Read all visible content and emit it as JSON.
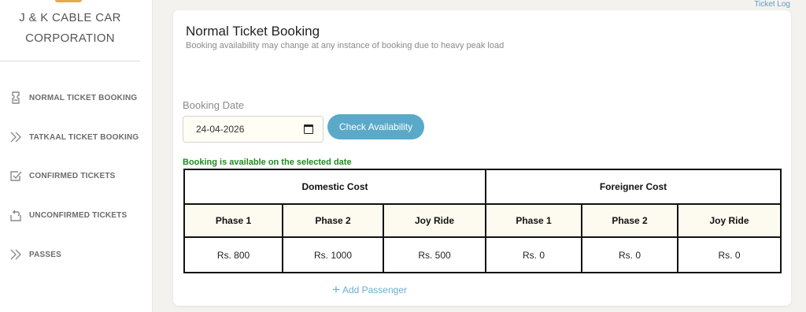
{
  "brand": {
    "line1": "J & K CABLE CAR",
    "line2": "CORPORATION"
  },
  "sidebar": {
    "items": [
      {
        "label": "NORMAL TICKET BOOKING",
        "icon": "ticket-icon"
      },
      {
        "label": "TATKAAL TICKET BOOKING",
        "icon": "double-chevron-icon"
      },
      {
        "label": "CONFIRMED TICKETS",
        "icon": "checkbox-icon"
      },
      {
        "label": "UNCONFIRMED TICKETS",
        "icon": "return-arrow-icon"
      },
      {
        "label": "PASSES",
        "icon": "double-chevron-icon"
      }
    ]
  },
  "header": {
    "ticket_log": "Ticket Log"
  },
  "main": {
    "title": "Normal Ticket Booking",
    "subtitle": "Booking availability may change at any instance of booking due to heavy peak load",
    "booking_date_label": "Booking Date",
    "booking_date_value": "24-04-2026",
    "check_button": "Check Availability",
    "availability_message": "Booking is available on the selected date",
    "table": {
      "groups": [
        "Domestic Cost",
        "Foreigner Cost"
      ],
      "phases": [
        "Phase 1",
        "Phase 2",
        "Joy Ride",
        "Phase 1",
        "Phase 2",
        "Joy Ride"
      ],
      "prices": [
        "Rs. 800",
        "Rs. 1000",
        "Rs. 500",
        "Rs. 0",
        "Rs. 0",
        "Rs. 0"
      ]
    },
    "add_passenger": "Add Passenger"
  },
  "colors": {
    "accent": "#5ba9c9",
    "success": "#1f8a1f",
    "link": "#5b9cc0",
    "logo": "#e8a94a"
  }
}
